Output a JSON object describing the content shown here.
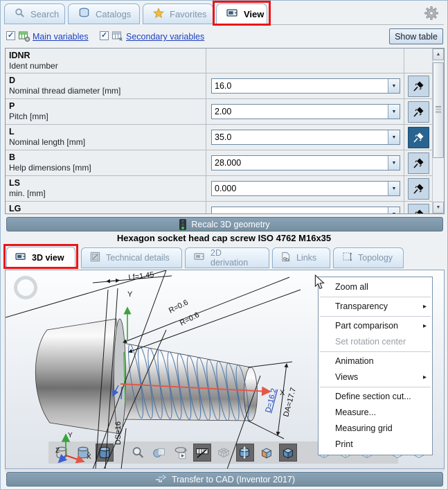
{
  "colors": {
    "accent_bar": "#7e96ab",
    "annotation_red": "#ec1515",
    "pin_active_bg": "#29638f",
    "link_blue": "#1b3fc0",
    "thread_blue": "#3f6fa8"
  },
  "icons": {
    "check_glyph": "✓",
    "combo_arrow_glyph": "▼",
    "scroll_up_glyph": "▲",
    "scroll_down_glyph": "▼",
    "submenu_arrow_glyph": "▸"
  },
  "top_tabs": {
    "items": [
      {
        "label": "Search",
        "icon": "search-icon",
        "active": false
      },
      {
        "label": "Catalogs",
        "icon": "catalogs-icon",
        "active": false
      },
      {
        "label": "Favorites",
        "icon": "star-icon",
        "active": false
      },
      {
        "label": "View",
        "icon": "view-icon",
        "active": true
      }
    ]
  },
  "toolbar_row": {
    "main_variables": {
      "label": "Main variables",
      "checked": true
    },
    "secondary_variables": {
      "label": "Secondary variables",
      "checked": true
    },
    "show_table_label": "Show table"
  },
  "variables_table": {
    "rows": [
      {
        "name": "IDNR",
        "description": "Ident number",
        "value": "",
        "has_combo": false,
        "pinned": false
      },
      {
        "name": "D",
        "description": "Nominal thread diameter [mm]",
        "value": "16.0",
        "has_combo": true,
        "pinned": false
      },
      {
        "name": "P",
        "description": "Pitch [mm]",
        "value": "2.00",
        "has_combo": true,
        "pinned": false
      },
      {
        "name": "L",
        "description": "Nominal length [mm]",
        "value": "35.0",
        "has_combo": true,
        "pinned": true
      },
      {
        "name": "B",
        "description": "Help dimensions [mm]",
        "value": "28.000",
        "has_combo": true,
        "pinned": false
      },
      {
        "name": "LS",
        "description": "min. [mm]",
        "value": "0.000",
        "has_combo": true,
        "pinned": false
      },
      {
        "name": "LG",
        "description": "",
        "value": "",
        "has_combo": true,
        "pinned": false
      }
    ]
  },
  "recalc_button": {
    "label": "Recalc 3D geometry"
  },
  "part_title": "Hexagon socket head cap screw ISO 4762 M16x35",
  "view_tabs": {
    "items": [
      {
        "label": "3D view",
        "active": true
      },
      {
        "label": "Technical details",
        "active": false
      },
      {
        "label": "2D derivation",
        "active": false
      },
      {
        "label": "Links",
        "active": false
      },
      {
        "label": "Topology",
        "active": false
      }
    ]
  },
  "viewport": {
    "dimensions": {
      "lf": "Lf=1.45",
      "r1": "R=0.6",
      "r2": "R=0.6",
      "ds": "DS=16",
      "d": "D=16.2",
      "da": "DA=17.7"
    },
    "axes": {
      "x": "X",
      "y": "Y",
      "triad_x": "X",
      "triad_y": "Y",
      "triad_z": "Z"
    }
  },
  "context_menu": {
    "items": [
      {
        "label": "Zoom all"
      },
      {
        "label": "Transparency",
        "submenu": true
      },
      {
        "label": "Part comparison",
        "submenu": true
      },
      {
        "label": "Set rotation center",
        "disabled": true
      },
      {
        "label": "Animation"
      },
      {
        "label": "Views",
        "submenu": true
      },
      {
        "label": "Define section cut..."
      },
      {
        "label": "Measure..."
      },
      {
        "label": "Measuring grid"
      },
      {
        "label": "Print"
      }
    ]
  },
  "transfer_button": {
    "label": "Transfer to CAD (Inventor 2017)"
  }
}
